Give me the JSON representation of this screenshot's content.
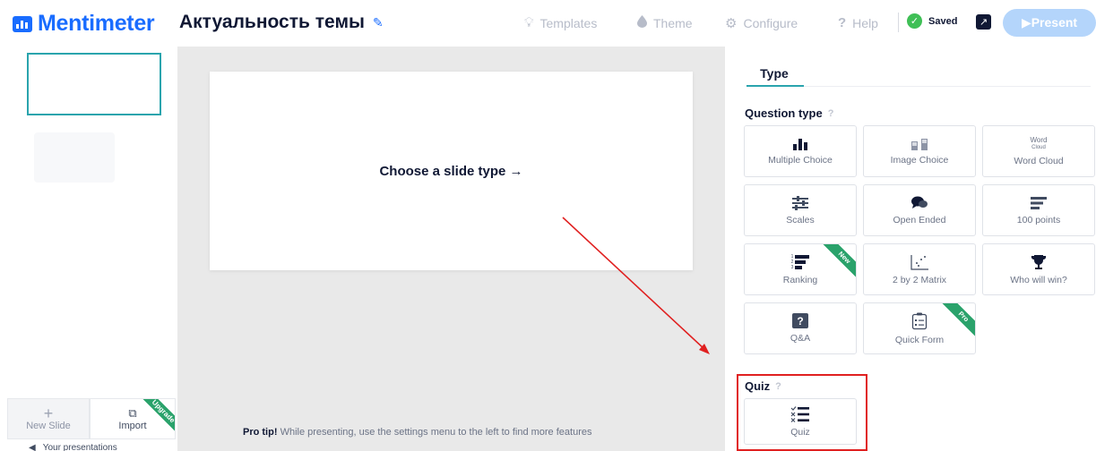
{
  "header": {
    "logo_text": "Mentimeter",
    "presentation_title": "Актуальность темы",
    "nav": {
      "templates": "Templates",
      "theme": "Theme",
      "configure": "Configure",
      "help": "Help"
    },
    "saved_label": "Saved",
    "present_label": "▶Present"
  },
  "left_panel": {
    "new_slide_label": "New Slide",
    "import_label": "Import",
    "import_badge": "Upgrade",
    "your_presentations": "Your presentations"
  },
  "canvas": {
    "choose_slide_type": "Choose a slide type →",
    "protip_bold": "Pro tip!",
    "protip_text": "While presenting, use the settings menu to the left to find more features"
  },
  "right_panel": {
    "tab_label": "Type",
    "question_type_label": "Question type",
    "quiz_label": "Quiz",
    "help_mark": "?",
    "tiles": [
      {
        "label": "Multiple Choice",
        "icon": "bar-chart-icon"
      },
      {
        "label": "Image Choice",
        "icon": "image-choice-icon"
      },
      {
        "label": "Word Cloud",
        "icon": "word-cloud-icon",
        "icon_text": [
          "Word",
          "Cloud"
        ]
      },
      {
        "label": "Scales",
        "icon": "scales-icon"
      },
      {
        "label": "Open Ended",
        "icon": "speech-bubbles-icon"
      },
      {
        "label": "100 points",
        "icon": "lines-icon"
      },
      {
        "label": "Ranking",
        "icon": "ranking-icon",
        "badge": "New",
        "icon_text": [
          "1",
          "2",
          "3"
        ]
      },
      {
        "label": "2 by 2 Matrix",
        "icon": "matrix-icon"
      },
      {
        "label": "Who will win?",
        "icon": "trophy-icon"
      },
      {
        "label": "Q&A",
        "icon": "qa-icon",
        "icon_text": "?"
      },
      {
        "label": "Quick Form",
        "icon": "form-icon",
        "badge": "Pro"
      }
    ],
    "quiz_tile": {
      "label": "Quiz",
      "icon": "quiz-list-icon"
    }
  },
  "colors": {
    "brand_blue": "#196cff",
    "teal": "#2aa4ad",
    "badge_green": "#2aa26b",
    "highlight_red": "#e02020",
    "present_button": "#b4d5fb"
  }
}
